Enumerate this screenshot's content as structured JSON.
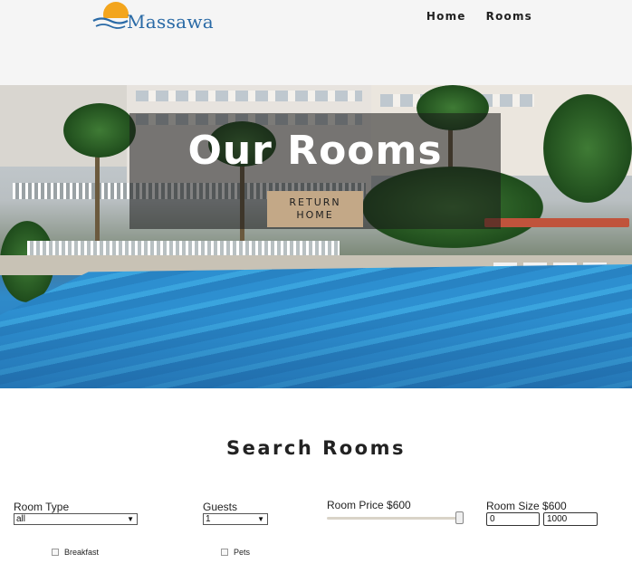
{
  "brand": {
    "name": "Massawa",
    "logo_icon": "sun-over-waves-icon"
  },
  "nav": {
    "items": [
      {
        "label": "Home"
      },
      {
        "label": "Rooms"
      }
    ]
  },
  "hero": {
    "title": "Our Rooms",
    "button_label": "RETURN HOME"
  },
  "search": {
    "title": "Search Rooms",
    "room_type": {
      "label": "Room Type",
      "value": "all"
    },
    "guests": {
      "label": "Guests",
      "value": "1"
    },
    "room_price": {
      "label": "Room Price $600",
      "value": 600
    },
    "room_size": {
      "label": "Room Size $600",
      "min_value": "0",
      "max_value": "1000"
    },
    "checkboxes": [
      {
        "label": "Breakfast"
      },
      {
        "label": "Pets"
      }
    ]
  },
  "colors": {
    "brand_blue": "#2a6aa6",
    "sun": "#f3a51d",
    "button_tan": "#c3a887",
    "nav_bg": "#f5f5f5"
  }
}
